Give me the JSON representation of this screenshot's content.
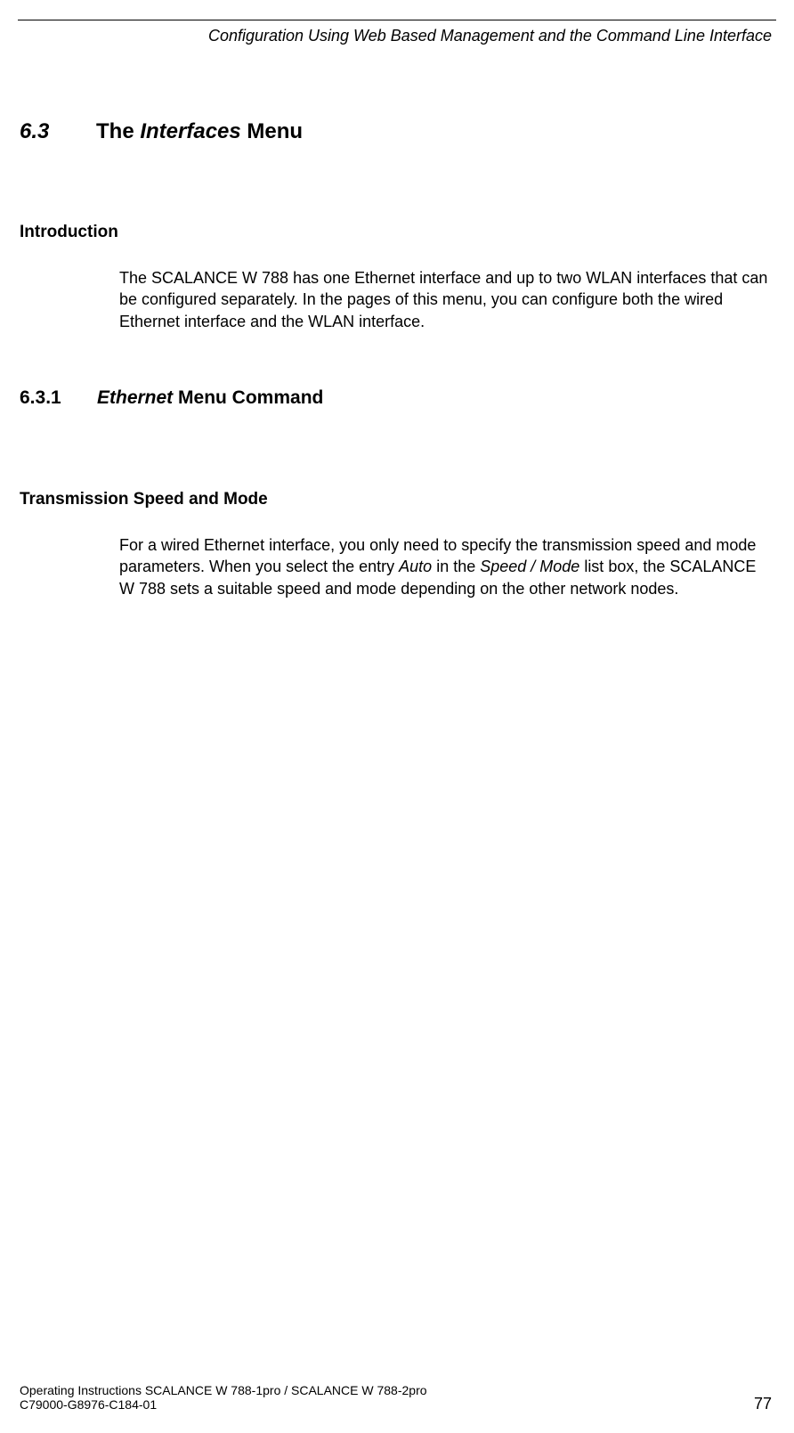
{
  "header": {
    "title": "Configuration Using Web Based Management and the Command Line Interface"
  },
  "section": {
    "number": "6.3",
    "title_prefix": "The ",
    "title_italic": "Interfaces",
    "title_suffix": " Menu"
  },
  "introduction": {
    "heading": "Introduction",
    "body": "The SCALANCE W 788 has one Ethernet interface and up to two WLAN interfaces that can be configured separately. In the pages of this menu, you can configure both the wired Ethernet interface and the WLAN interface."
  },
  "subsection": {
    "number": "6.3.1",
    "title_italic": "Ethernet",
    "title_suffix": " Menu Command"
  },
  "transmission": {
    "heading": "Transmission Speed and Mode",
    "body_part1": "For a wired Ethernet interface, you only need to specify the transmission speed and mode parameters. When you select the entry ",
    "body_italic1": "Auto",
    "body_part2": " in the ",
    "body_italic2": "Speed / Mode",
    "body_part3": " list box, the SCALANCE W 788 sets a suitable speed and mode depending on the other network nodes."
  },
  "footer": {
    "line1": "Operating Instructions SCALANCE W 788-1pro / SCALANCE W 788-2pro",
    "line2": "C79000-G8976-C184-01",
    "page": "77"
  }
}
